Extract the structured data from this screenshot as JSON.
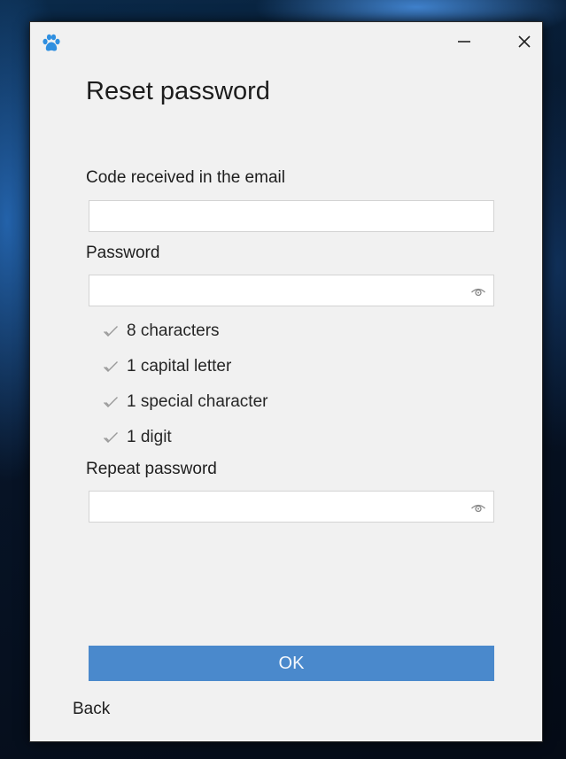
{
  "window": {
    "minimize_icon": "minimize-icon",
    "close_icon": "close-icon",
    "app_icon": "paw-icon",
    "accent_color": "#4a89cc"
  },
  "form": {
    "title": "Reset password",
    "code": {
      "label": "Code received in the email",
      "value": ""
    },
    "password": {
      "label": "Password",
      "value": "",
      "toggle_icon": "eye-icon"
    },
    "rules": [
      {
        "icon": "check-icon",
        "text": "8 characters"
      },
      {
        "icon": "check-icon",
        "text": "1 capital letter"
      },
      {
        "icon": "check-icon",
        "text": "1 special character"
      },
      {
        "icon": "check-icon",
        "text": "1 digit"
      }
    ],
    "repeat_password": {
      "label": "Repeat password",
      "value": "",
      "toggle_icon": "eye-icon"
    },
    "ok_label": "OK",
    "back_label": "Back"
  }
}
